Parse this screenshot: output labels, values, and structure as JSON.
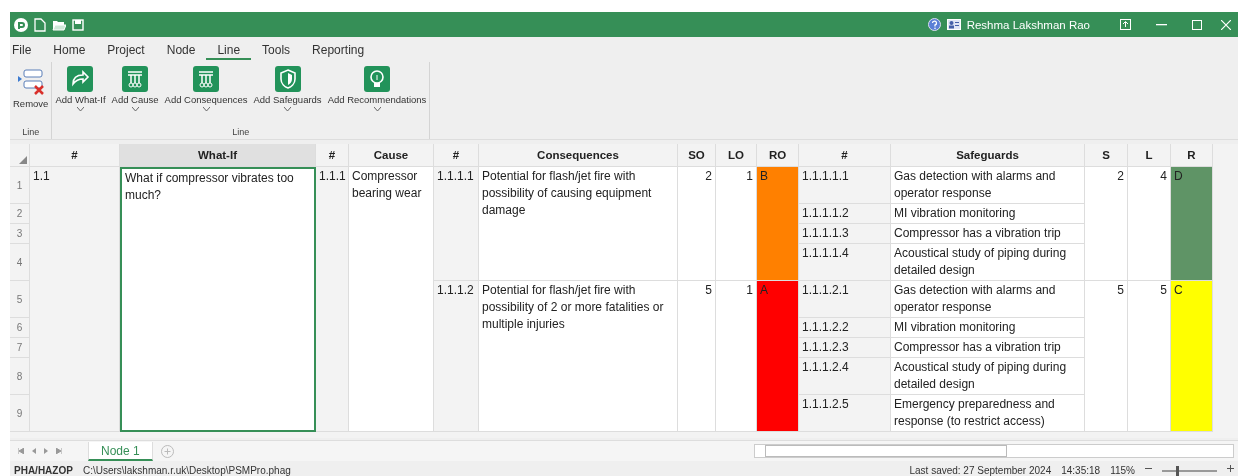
{
  "title_bar": {
    "user": "Reshma Lakshman Rao"
  },
  "menu": [
    {
      "label": "File",
      "selected": false
    },
    {
      "label": "Home",
      "selected": false
    },
    {
      "label": "Project",
      "selected": false
    },
    {
      "label": "Node",
      "selected": false
    },
    {
      "label": "Line",
      "selected": true
    },
    {
      "label": "Tools",
      "selected": false
    },
    {
      "label": "Reporting",
      "selected": false
    }
  ],
  "ribbon": {
    "groups": [
      {
        "label": "Line",
        "buttons": [
          {
            "label": "Remove",
            "kind": "remove",
            "dropdown": false
          }
        ]
      },
      {
        "label": "Line",
        "buttons": [
          {
            "label": "Add What-If",
            "kind": "what-if",
            "dropdown": true
          },
          {
            "label": "Add Cause",
            "kind": "cause",
            "dropdown": true
          },
          {
            "label": "Add Consequences",
            "kind": "consequences",
            "dropdown": true
          },
          {
            "label": "Add Safeguards",
            "kind": "safeguards",
            "dropdown": true
          },
          {
            "label": "Add Recommendations",
            "kind": "recommendations",
            "dropdown": true
          }
        ]
      }
    ]
  },
  "grid": {
    "columns": [
      "#",
      "What-If",
      "#",
      "Cause",
      "#",
      "Consequences",
      "SO",
      "LO",
      "RO",
      "#",
      "Safeguards",
      "S",
      "L",
      "R"
    ],
    "row_numbers": [
      "1",
      "2",
      "3",
      "4",
      "5",
      "6",
      "7",
      "8",
      "9"
    ],
    "what_ifs": [
      {
        "number": "1.1",
        "text": "What if compressor vibrates too much?",
        "selected": true,
        "causes": [
          {
            "number": "1.1.1",
            "text": "Compressor bearing wear",
            "consequences": [
              {
                "number": "1.1.1.1",
                "text": "Potential for flash/jet fire with possibility of causing equipment damage",
                "so": "2",
                "lo": "1",
                "ro": {
                  "text": "B",
                  "color": "#ff8000"
                },
                "s": "2",
                "l": "4",
                "r": {
                  "text": "D",
                  "color": "#5f9466"
                },
                "safeguards": [
                  {
                    "number": "1.1.1.1.1",
                    "text": "Gas detection with alarms and operator response"
                  },
                  {
                    "number": "1.1.1.1.2",
                    "text": "MI vibration monitoring"
                  },
                  {
                    "number": "1.1.1.1.3",
                    "text": "Compressor has a vibration trip"
                  },
                  {
                    "number": "1.1.1.1.4",
                    "text": "Acoustical study of piping during detailed design"
                  }
                ]
              },
              {
                "number": "1.1.1.2",
                "text": "Potential for flash/jet fire with possibility of  2 or more fatalities or multiple injuries",
                "so": "5",
                "lo": "1",
                "ro": {
                  "text": "A",
                  "color": "#ff0000"
                },
                "s": "5",
                "l": "5",
                "r": {
                  "text": "C",
                  "color": "#ffff00"
                },
                "safeguards": [
                  {
                    "number": "1.1.1.2.1",
                    "text": "Gas detection with alarms and operator response"
                  },
                  {
                    "number": "1.1.1.2.2",
                    "text": "MI vibration monitoring"
                  },
                  {
                    "number": "1.1.1.2.3",
                    "text": "Compressor has a vibration trip"
                  },
                  {
                    "number": "1.1.1.2.4",
                    "text": "Acoustical study of piping during detailed design"
                  },
                  {
                    "number": "1.1.1.2.5",
                    "text": "Emergency preparedness and response (to restrict access)"
                  }
                ]
              }
            ]
          }
        ]
      }
    ]
  },
  "sheet_tabs": [
    {
      "label": "Node 1",
      "selected": true
    }
  ],
  "status_bar": {
    "mode": "PHA/HAZOP",
    "path": "C:\\Users\\lakshman.r.uk\\Desktop\\PSMPro.phag",
    "last_saved": "Last saved: 27 September 2024",
    "time": "14:35:18",
    "zoom": "115%",
    "zoom_slider": {
      "level": 0.25
    }
  }
}
